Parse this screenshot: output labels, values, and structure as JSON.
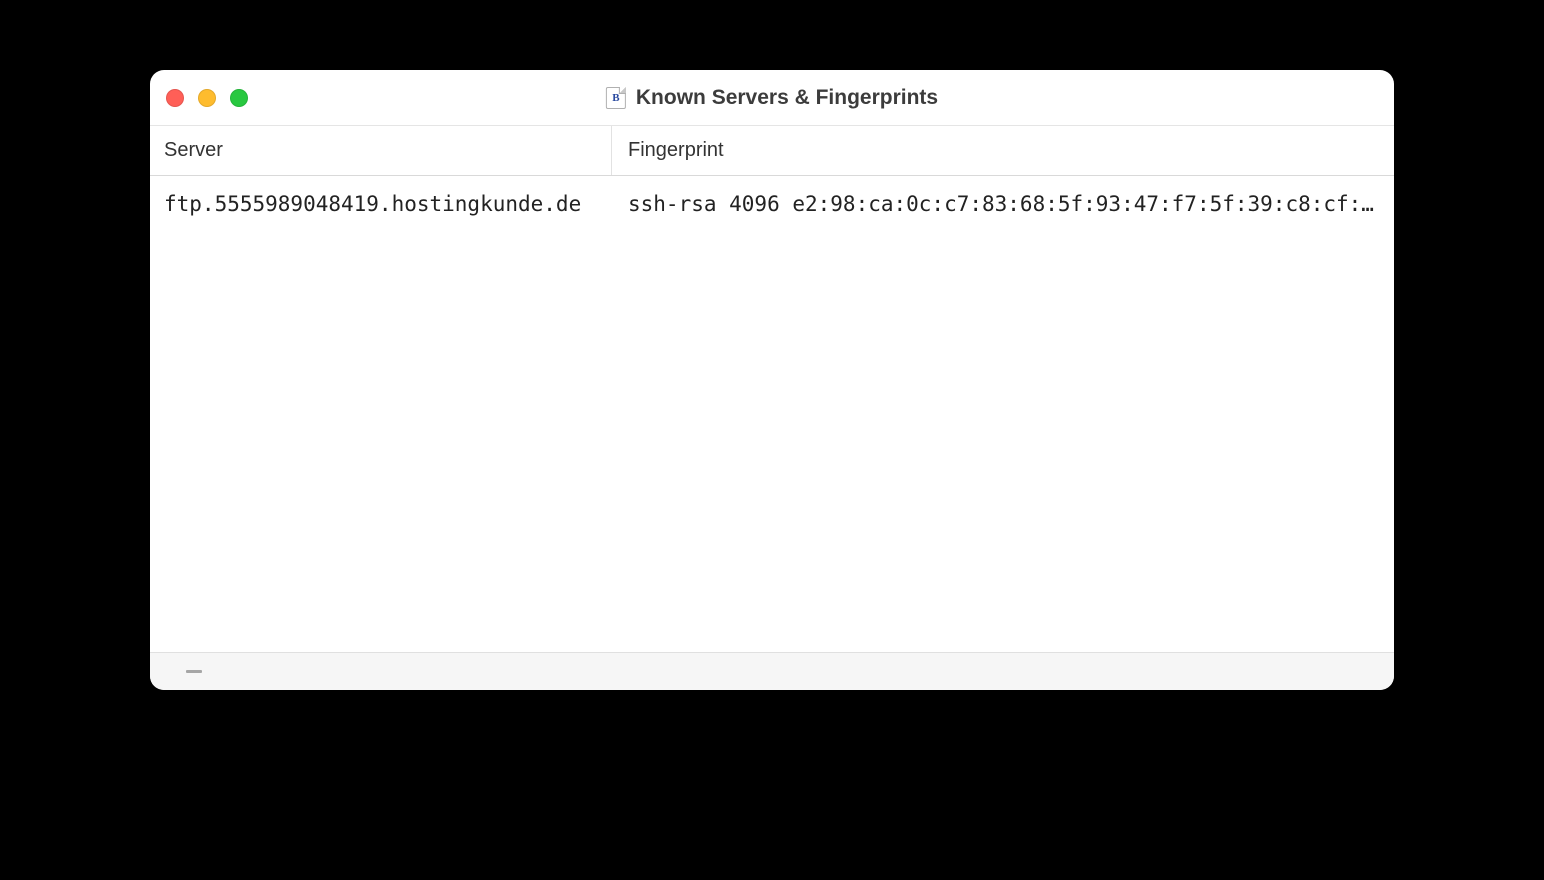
{
  "window": {
    "title": "Known Servers & Fingerprints",
    "app_icon_letter": "B"
  },
  "columns": {
    "server": "Server",
    "fingerprint": "Fingerprint"
  },
  "rows": [
    {
      "server": "ftp.5555989048419.hostingkunde.de",
      "fingerprint": "ssh-rsa 4096 e2:98:ca:0c:c7:83:68:5f:93:47:f7:5f:39:c8:cf:…"
    }
  ]
}
